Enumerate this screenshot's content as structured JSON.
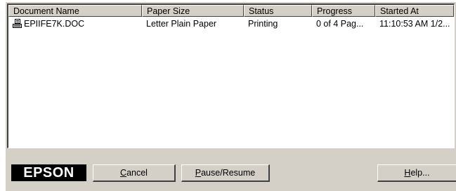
{
  "columns": [
    "Document Name",
    "Paper Size",
    "Status",
    "Progress",
    "Started At"
  ],
  "rows": [
    {
      "document_name": "EPIIFE7K.DOC",
      "paper_size": "Letter Plain Paper",
      "status": "Printing",
      "progress": "0 of 4 Pag...",
      "started_at": "11:10:53 AM 1/2..."
    }
  ],
  "logo": "EPSON",
  "buttons": {
    "cancel": {
      "mnemonic": "C",
      "rest": "ancel"
    },
    "pause_resume": {
      "mnemonic": "P",
      "rest": "ause/Resume"
    },
    "help": {
      "mnemonic": "H",
      "rest": "elp..."
    }
  }
}
